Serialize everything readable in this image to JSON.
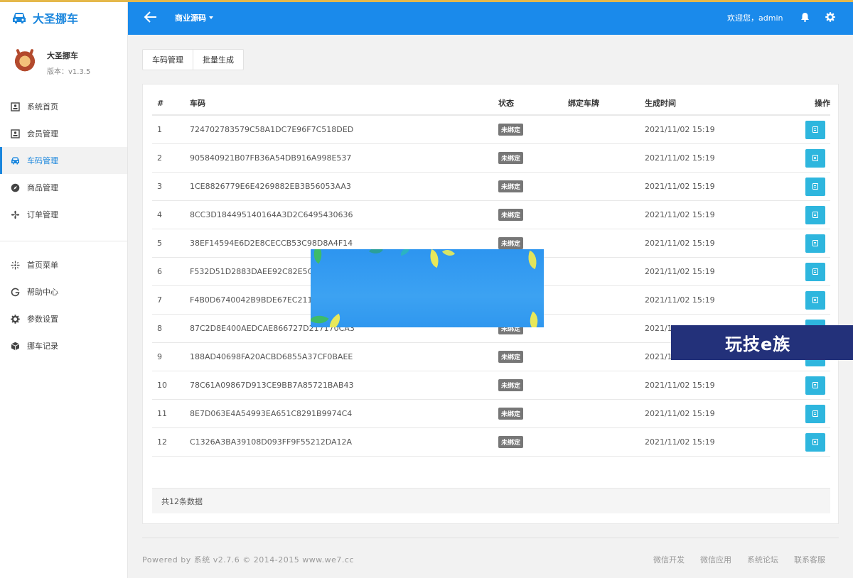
{
  "app": {
    "brand": "大圣挪车"
  },
  "profile": {
    "name": "大圣挪车",
    "version": "版本：v1.3.5"
  },
  "sidebar": {
    "items": [
      {
        "label": "系统首页",
        "icon": "home-icon"
      },
      {
        "label": "会员管理",
        "icon": "user-icon"
      },
      {
        "label": "车码管理",
        "icon": "car-icon",
        "active": true
      },
      {
        "label": "商品管理",
        "icon": "compass-icon"
      },
      {
        "label": "订单管理",
        "icon": "fan-icon"
      }
    ],
    "items2": [
      {
        "label": "首页菜单",
        "icon": "crosshair-icon"
      },
      {
        "label": "帮助中心",
        "icon": "google-icon"
      },
      {
        "label": "参数设置",
        "icon": "gear-icon"
      },
      {
        "label": "挪车记录",
        "icon": "cube-icon"
      }
    ]
  },
  "header": {
    "title": "商业源码",
    "welcome": "欢迎您，admin"
  },
  "toolbar": {
    "btn1": "车码管理",
    "btn2": "批量生成"
  },
  "table": {
    "headers": {
      "num": "#",
      "code": "车码",
      "status": "状态",
      "plate": "绑定车牌",
      "time": "生成时间",
      "op": "操作"
    },
    "rows": [
      {
        "num": "1",
        "code": "724702783579C58A1DC7E96F7C518DED",
        "status": "未绑定",
        "time": "2021/11/02 15:19"
      },
      {
        "num": "2",
        "code": "905840921B07FB36A54DB916A998E537",
        "status": "未绑定",
        "time": "2021/11/02 15:19"
      },
      {
        "num": "3",
        "code": "1CE8826779E6E4269882EB3B56053AA3",
        "status": "未绑定",
        "time": "2021/11/02 15:19"
      },
      {
        "num": "4",
        "code": "8CC3D184495140164A3D2C6495430636",
        "status": "未绑定",
        "time": "2021/11/02 15:19"
      },
      {
        "num": "5",
        "code": "38EF14594E6D2E8CECCB53C98D8A4F14",
        "status": "未绑定",
        "time": "2021/11/02 15:19"
      },
      {
        "num": "6",
        "code": "F532D51D2883DAEE92C82E5C9",
        "status": "",
        "time": "2021/11/02 15:19"
      },
      {
        "num": "7",
        "code": "F4B0D6740042B9BDE67EC2110",
        "status": "",
        "time": "2021/11/02 15:19"
      },
      {
        "num": "8",
        "code": "87C2D8E400AEDCAE866727D217170CA3",
        "status": "未绑定",
        "time": "2021/11/"
      },
      {
        "num": "9",
        "code": "188AD40698FA20ACBD6855A37CF0BAEE",
        "status": "未绑定",
        "time": "2021/11/"
      },
      {
        "num": "10",
        "code": "78C61A09867D913CE9BB7A85721BAB43",
        "status": "未绑定",
        "time": "2021/11/02 15:19"
      },
      {
        "num": "11",
        "code": "8E7D063E4A54993EA651C8291B9974C4",
        "status": "未绑定",
        "time": "2021/11/02 15:19"
      },
      {
        "num": "12",
        "code": "C1326A3BA39108D093FF9F55212DA12A",
        "status": "未绑定",
        "time": "2021/11/02 15:19"
      }
    ],
    "total": "共12条数据"
  },
  "watermark": "玩技e族",
  "footer": {
    "powered": "Powered by 系统 v2.7.6 © 2014-2015 www.we7.cc",
    "links": [
      "微信开发",
      "微信应用",
      "系统论坛",
      "联系客服"
    ]
  },
  "colors": {
    "primary": "#1a8aeb",
    "accent": "#2eb6de",
    "badge": "#777777",
    "watermark_bg": "#23317a"
  }
}
